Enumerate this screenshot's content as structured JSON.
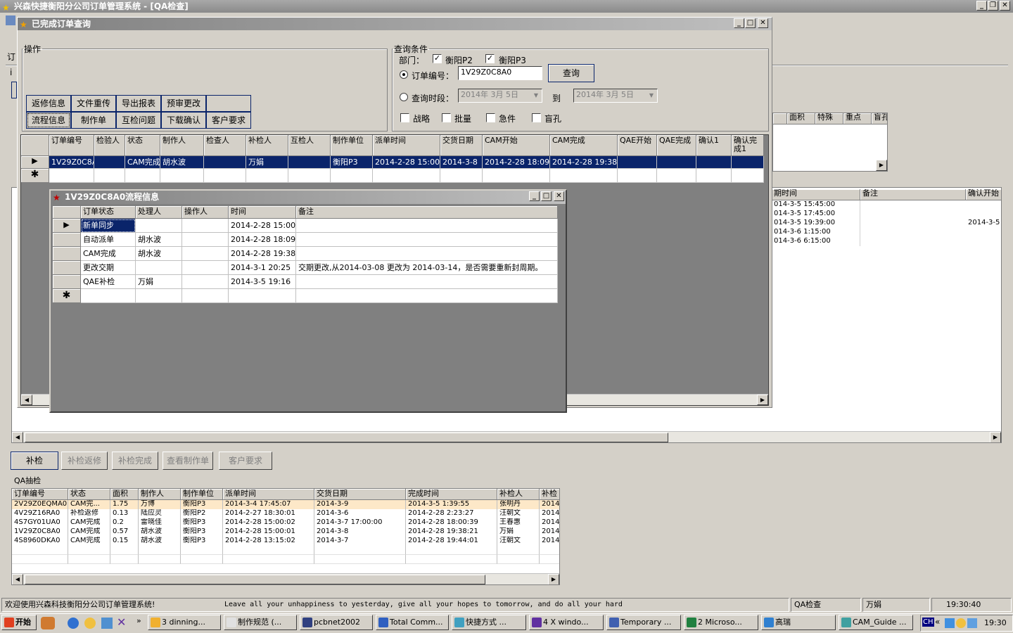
{
  "app": {
    "title": "兴森快捷衡阳分公司订单管理系统 - [QA检查]",
    "bg_labels": [
      "订",
      "i"
    ]
  },
  "completed_window": {
    "title": "已完成订单查询",
    "ops_group": "操作",
    "ops_buttons_row1": [
      "返修信息",
      "文件重传",
      "导出报表",
      "预审更改",
      ""
    ],
    "ops_buttons_row2": [
      "流程信息",
      "制作单",
      "互检问题",
      "下载确认",
      "客户要求"
    ],
    "query_group": "查询条件",
    "dept_label": "部门：",
    "dept1": "衡阳P2",
    "dept2": "衡阳P3",
    "order_no_label": "订单编号：",
    "order_no_value": "1V29Z0C8A0",
    "query_button": "查询",
    "period_label": "查询时段：",
    "date_from": "2014年 3月 5日",
    "to_label": "到",
    "date_to": "2014年 3月 5日",
    "flags": [
      "战略",
      "批量",
      "急件",
      "盲孔"
    ],
    "columns": [
      "订单编号",
      "检验人",
      "状态",
      "制作人",
      "检查人",
      "补检人",
      "互检人",
      "制作单位",
      "派单时间",
      "交货日期",
      "CAM开始",
      "CAM完成",
      "QAE开始",
      "QAE完成",
      "确认1",
      "确认完成1"
    ],
    "row": [
      "1V29Z0C8A0",
      "",
      "CAM完成",
      "胡水波",
      "",
      "万娟",
      "",
      "衡阳P3",
      "2014-2-28 15:00",
      "2014-3-8",
      "2014-2-28 18:09",
      "2014-2-28 19:38",
      "",
      "",
      "",
      ""
    ]
  },
  "flow_window": {
    "title": "1V29Z0C8A0流程信息",
    "columns": [
      "订单状态",
      "处理人",
      "操作人",
      "时间",
      "备注"
    ],
    "rows": [
      [
        "新单同步",
        "",
        "",
        "2014-2-28 15:00",
        ""
      ],
      [
        "自动派单",
        "胡水波",
        "",
        "2014-2-28 18:09",
        ""
      ],
      [
        "CAM完成",
        "胡水波",
        "",
        "2014-2-28 19:38",
        ""
      ],
      [
        "更改交期",
        "",
        "",
        "2014-3-1 20:25",
        "交期更改,从2014-03-08 更改为 2014-03-14，是否需要重新封周期。"
      ],
      [
        "QAE补检",
        "万娟",
        "",
        "2014-3-5 19:16",
        ""
      ]
    ]
  },
  "bg_right_grid": {
    "columns": [
      "面积",
      "特殊",
      "重点",
      "盲孔"
    ]
  },
  "bg_times_grid": {
    "columns": [
      "期时间",
      "备注",
      "确认开始"
    ],
    "rows": [
      [
        "014-3-5 15:45:00",
        "",
        ""
      ],
      [
        "014-3-5 17:45:00",
        "",
        ""
      ],
      [
        "014-3-5 19:39:00",
        "",
        "2014-3-5"
      ],
      [
        "014-3-6 1:15:00",
        "",
        ""
      ],
      [
        "014-3-6 6:15:00",
        "",
        ""
      ]
    ]
  },
  "qa_buttons": [
    "补检",
    "补检返修",
    "补检完成",
    "查看制作单",
    "客户要求"
  ],
  "qa_sample": {
    "label": "QA抽检",
    "columns": [
      "订单编号",
      "状态",
      "面积",
      "制作人",
      "制作单位",
      "派单时间",
      "交货日期",
      "完成时间",
      "补检人",
      "补检"
    ],
    "rows": [
      [
        "2V29Z0EQMA0",
        "CAM完...",
        "1.75",
        "万博",
        "衡阳P3",
        "2014-3-4 17:45:07",
        "2014-3-9",
        "2014-3-5 1:39:55",
        "张明丹",
        "2014"
      ],
      [
        "4V29Z16RA0",
        "补检返修",
        "0.13",
        "陆应灵",
        "衡阳P2",
        "2014-2-27 18:30:01",
        "2014-3-6",
        "2014-2-28 2:23:27",
        "汪朝文",
        "2014"
      ],
      [
        "4S7GY01UA0",
        "CAM完成",
        "0.2",
        "雷晓佳",
        "衡阳P3",
        "2014-2-28 15:00:02",
        "2014-3-7 17:00:00",
        "2014-2-28 18:00:39",
        "王春惠",
        "2014"
      ],
      [
        "1V29Z0C8A0",
        "CAM完成",
        "0.57",
        "胡水波",
        "衡阳P3",
        "2014-2-28 15:00:01",
        "2014-3-8",
        "2014-2-28 19:38:21",
        "万娟",
        "2014"
      ],
      [
        "4S8960DKA0",
        "CAM完成",
        "0.15",
        "胡水波",
        "衡阳P3",
        "2014-2-28 13:15:02",
        "2014-3-7",
        "2014-2-28 19:44:01",
        "汪朝文",
        "2014"
      ]
    ]
  },
  "status": {
    "welcome": "欢迎使用兴森科技衡阳分公司订单管理系统!",
    "marquee": "Leave all your unhappiness to yesterday, give all your hopes to tomorrow, and do all your hard",
    "module": "QA检查",
    "user": "万娟",
    "time": "19:30:40"
  },
  "taskbar": {
    "start": "开始",
    "buttons": [
      "3 dinning...",
      "制作规范 (...",
      "pcbnet2002",
      "Total Comm...",
      "快捷方式 ...",
      "4 X windo...",
      "Temporary ...",
      "2 Microso...",
      "高瑞",
      "CAM_Guide ..."
    ],
    "clock": "19:30",
    "tray_label": "CH"
  }
}
